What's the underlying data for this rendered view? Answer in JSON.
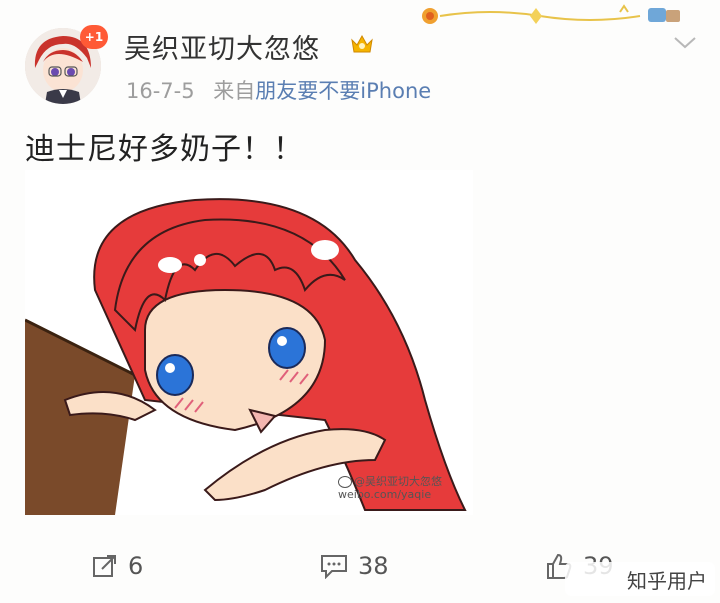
{
  "post": {
    "author": "吴织亚切大忽悠",
    "unread_badge": "+1",
    "date": "16-7-5",
    "source_prefix": "来自",
    "source": "朋友要不要iPhone",
    "content": "迪士尼好多奶子！！"
  },
  "image": {
    "watermark_line1": "@吴织亚切大忽悠",
    "watermark_line2": "weibo.com/yaqie"
  },
  "actions": {
    "repost_count": "6",
    "comment_count": "38",
    "like_count": "39"
  },
  "overlay": {
    "zhihu_label": "知乎用户"
  },
  "colors": {
    "badge": "#ff5a36",
    "source_link": "#5a7eb2",
    "crown": "#f5b400",
    "hair": "#e63b3b",
    "eyes": "#2b74d8"
  },
  "icons": [
    "avatar",
    "vip-crown-icon",
    "chevron-down-icon",
    "repost-icon",
    "comment-icon",
    "like-icon",
    "weibo-logo-icon"
  ]
}
